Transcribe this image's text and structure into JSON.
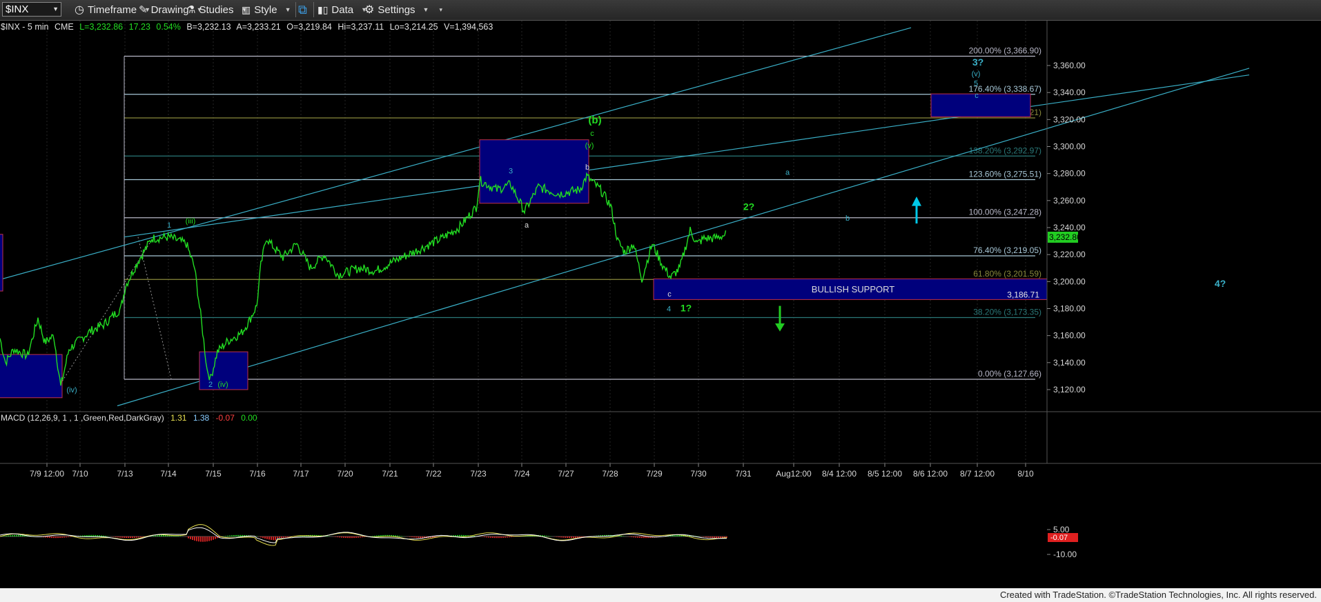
{
  "toolbar": {
    "symbol": "$INX",
    "timeframe": "Timeframe",
    "drawing": "Drawing",
    "studies": "Studies",
    "style": "Style",
    "data": "Data",
    "settings": "Settings"
  },
  "header": {
    "symbol": "$INX - 5 min",
    "exchange": "CME",
    "last": "L=3,232.86",
    "change": "17.23",
    "change_pct": "0.54%",
    "bid": "B=3,232.13",
    "ask": "A=3,233.21",
    "open": "O=3,219.84",
    "high": "Hi=3,237.11",
    "low": "Lo=3,214.25",
    "volume": "V=1,394,563"
  },
  "price_axis": {
    "ticks": [
      3120,
      3140,
      3160,
      3180,
      3200,
      3220,
      3240,
      3260,
      3280,
      3300,
      3320,
      3340,
      3360
    ],
    "tick_labels": [
      "3,120.00",
      "3,140.00",
      "3,160.00",
      "3,180.00",
      "3,200.00",
      "3,220.00",
      "3,240.00",
      "3,260.00",
      "3,280.00",
      "3,300.00",
      "3,320.00",
      "3,340.00",
      "3,360.00"
    ],
    "last_label": "3,232.86",
    "support_label": "3,186.71"
  },
  "time_axis": {
    "labels": [
      "7/9 12:00",
      "7/10",
      "7/13",
      "7/14",
      "7/15",
      "7/16",
      "7/17",
      "7/20",
      "7/21",
      "7/22",
      "7/23",
      "7/24",
      "7/27",
      "7/28",
      "7/29",
      "7/30",
      "7/31",
      "Aug12:00",
      "8/4 12:00",
      "8/5 12:00",
      "8/6 12:00",
      "8/7 12:00",
      "8/10"
    ]
  },
  "fibonacci": [
    {
      "label": "200.00% (3,366.90)",
      "price": 3366.9,
      "color": "#b8b8c8"
    },
    {
      "label": "176.40% (3,338.67)",
      "price": 3338.67,
      "color": "#a8c8d8"
    },
    {
      "label": "161.80% (3,321.21)",
      "price": 3321.21,
      "color": "#8a8a3c"
    },
    {
      "label": "138.20% (3,292.97)",
      "price": 3292.97,
      "color": "#2a7878"
    },
    {
      "label": "123.60% (3,275.51)",
      "price": 3275.51,
      "color": "#a8c8d8"
    },
    {
      "label": "100.00% (3,247.28)",
      "price": 3247.28,
      "color": "#b8b8c8"
    },
    {
      "label": "76.40% (3,219.05)",
      "price": 3219.05,
      "color": "#a8c8d8"
    },
    {
      "label": "61.80% (3,201.59)",
      "price": 3201.59,
      "color": "#8a8a3c"
    },
    {
      "label": "38.20% (3,173.35)",
      "price": 3173.35,
      "color": "#2a7878"
    },
    {
      "label": "0.00% (3,127.66)",
      "price": 3127.66,
      "color": "#b8b8c8"
    }
  ],
  "boxes": {
    "support_label": "BULLISH SUPPORT"
  },
  "annotations": {
    "wave_1": "1",
    "wave_iii": "(iii)",
    "wave_2": "2",
    "wave_iv_low": "(iv)",
    "wave_iv": "(iv)",
    "wave_3": "3",
    "wave_a": "a",
    "wave_b": "b",
    "wave_v": "(v)",
    "wave_c": "c",
    "wave_b_paren": "(b)",
    "wave_c_low": "c",
    "wave_4": "4",
    "wave_1q": "1?",
    "wave_2q": "2?",
    "proj_a": "a",
    "proj_b": "b",
    "proj_3q": "3?",
    "proj_v": "(v)",
    "proj_5": "5",
    "proj_c": "c",
    "proj_4q": "4?"
  },
  "macd": {
    "label": "MACD (12,26,9, 1 , 1 ,Green,Red,DarkGray)",
    "v1": "1.31",
    "v2": "1.38",
    "v3": "-0.07",
    "v4": "0.00",
    "ticks": [
      "5.00",
      "-10.00"
    ],
    "last_label": "-0.07"
  },
  "footer": "Created with TradeStation. ©TradeStation Technologies, Inc. All rights reserved.",
  "colors": {
    "price": "#22dd22",
    "trendline": "#3ab0c8",
    "box_fill": "#00007c",
    "box_border": "#c0304a",
    "green_arrow": "#22cc22",
    "cyan_arrow": "#00c8e8"
  }
}
